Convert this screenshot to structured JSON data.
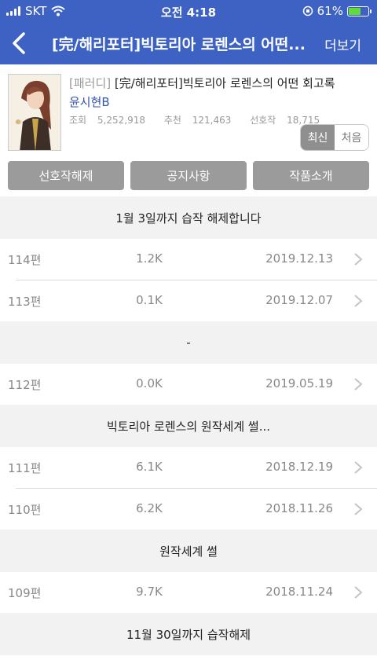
{
  "status_bar": {
    "carrier": "SKT",
    "time": "오전 4:18",
    "battery": "61%",
    "battery_level": 0.61
  },
  "navbar": {
    "title": "[完/해리포터]빅토리아 로렌스의 어떤...",
    "more_label": "더보기"
  },
  "novel": {
    "genre": "[패러디]",
    "title": "[完/해리포터]빅토리아 로렌스의 어떤 회고록",
    "author": "윤시현B",
    "views_label": "조회",
    "views": "5,252,918",
    "recommends_label": "추천",
    "recommends": "121,463",
    "favorites_label": "선호작",
    "favorites": "18,715"
  },
  "sort": {
    "latest": "최신",
    "first": "처음"
  },
  "buttons": {
    "unfavorite": "선호작해제",
    "notice": "공지사항",
    "intro": "작품소개"
  },
  "list": {
    "notice_1": "1월 3일까지 습작 해제합니다",
    "ep_114": {
      "num": "114편",
      "views": "1.2K",
      "date": "2019.12.13"
    },
    "ep_113": {
      "num": "113편",
      "views": "0.1K",
      "date": "2019.12.07"
    },
    "notice_2": "-",
    "ep_112": {
      "num": "112편",
      "views": "0.0K",
      "date": "2019.05.19"
    },
    "notice_3": "빅토리아 로렌스의 원작세계 썰...",
    "ep_111": {
      "num": "111편",
      "views": "6.1K",
      "date": "2018.12.19"
    },
    "ep_110": {
      "num": "110편",
      "views": "6.2K",
      "date": "2018.11.26"
    },
    "notice_4": "원작세계 썰",
    "ep_109": {
      "num": "109편",
      "views": "9.7K",
      "date": "2018.11.24"
    },
    "notice_5": "11월 30일까지 습작해제"
  }
}
